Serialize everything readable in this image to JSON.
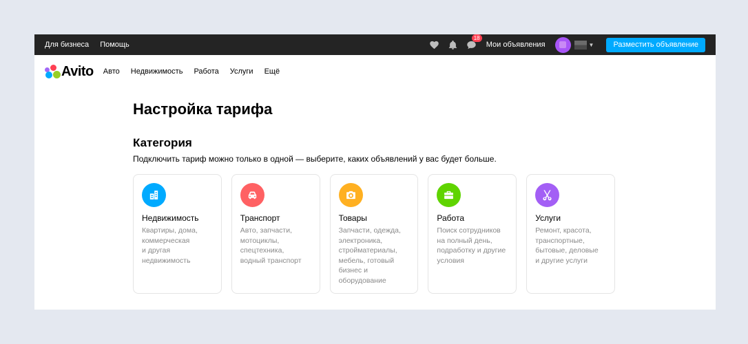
{
  "topbar": {
    "links": [
      "Для бизнеса",
      "Помощь"
    ],
    "messages_badge": "18",
    "my_ads": "Мои объявления",
    "post_button": "Разместить объявление"
  },
  "logo": {
    "text": "Avito"
  },
  "nav": {
    "items": [
      "Авто",
      "Недвижимость",
      "Работа",
      "Услуги",
      "Ещё"
    ]
  },
  "page": {
    "title": "Настройка тарифа",
    "section_title": "Категория",
    "description": "Подключить тариф можно только в одной — выберите, каких объявлений у вас будет больше."
  },
  "categories": [
    {
      "title": "Недвижимость",
      "desc": "Квартиры, дома,\nкоммерческая\nи другая\nнедвижимость",
      "icon": "building-icon",
      "color": "#00aaff"
    },
    {
      "title": "Транспорт",
      "desc": "Авто, запчасти,\nмотоциклы,\nспецтехника,\nводный транспорт",
      "icon": "car-icon",
      "color": "#ff6163"
    },
    {
      "title": "Товары",
      "desc": "Запчасти, одежда,\nэлектроника,\nстройматериалы,\nмебель, готовый\nбизнес и\nоборудование",
      "icon": "camera-icon",
      "color": "#ffb021"
    },
    {
      "title": "Работа",
      "desc": "Поиск сотрудников\nна полный день,\nподработку и другие\nусловия",
      "icon": "briefcase-icon",
      "color": "#5fd400"
    },
    {
      "title": "Услуги",
      "desc": "Ремонт, красота,\nтранспортные,\nбытовые, деловые\nи другие услуги",
      "icon": "scissors-icon",
      "color": "#a35ff5"
    }
  ]
}
